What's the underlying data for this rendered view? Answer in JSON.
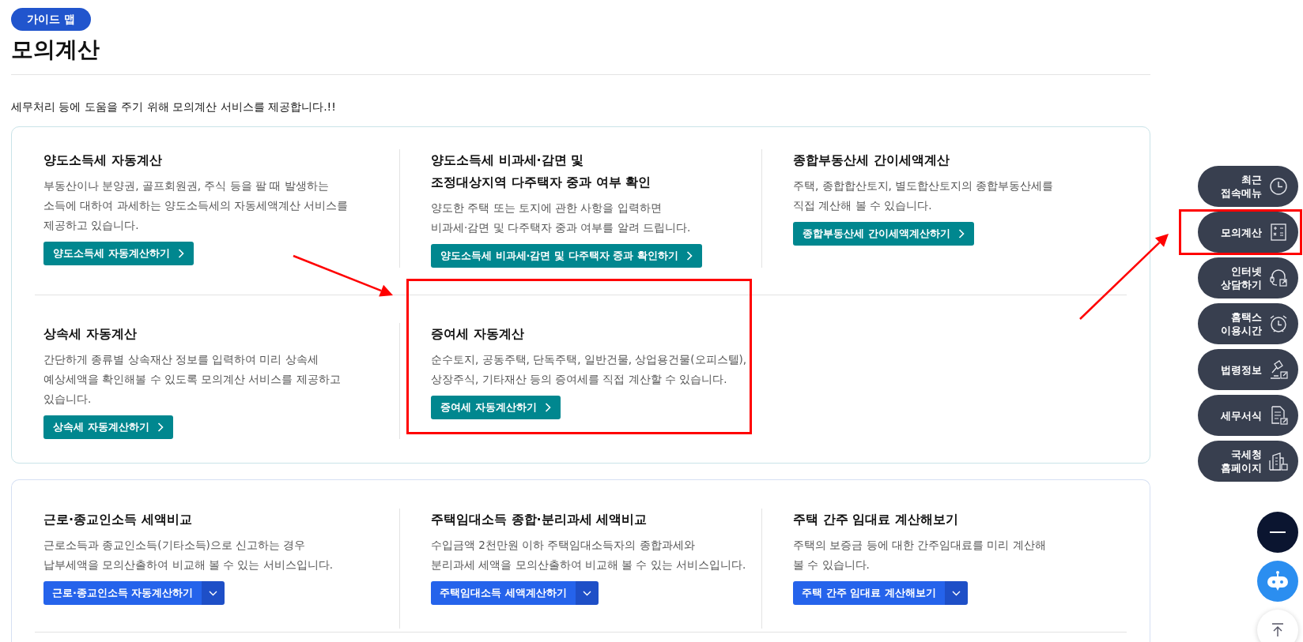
{
  "guide_badge": "가이드 맵",
  "page_title": "모의계산",
  "intro": "세무처리 등에 도움을 주기 위해 모의계산 서비스를 제공합니다.!!",
  "sections": [
    {
      "rows": [
        [
          {
            "title_lines": [
              "양도소득세 자동계산"
            ],
            "desc_lines": [
              "부동산이나 분양권, 골프회원권, 주식 등을 팔 때 발생하는",
              "소득에 대하여 과세하는 양도소득세의 자동세액계산 서비스를",
              "제공하고 있습니다."
            ],
            "button": {
              "kind": "link",
              "label": "양도소득세 자동계산하기"
            },
            "highlighted": false
          },
          {
            "title_lines": [
              "양도소득세 비과세·감면 및",
              "조정대상지역 다주택자 중과 여부 확인"
            ],
            "desc_lines": [
              "양도한 주택 또는 토지에 관한 사항을 입력하면",
              "비과세·감면 및 다주택자 중과 여부를 알려 드립니다."
            ],
            "button": {
              "kind": "link",
              "label": "양도소득세 비과세·감면 및 다주택자 중과 확인하기"
            },
            "highlighted": false
          },
          {
            "title_lines": [
              "종합부동산세 간이세액계산"
            ],
            "desc_lines": [
              "주택, 종합합산토지, 별도합산토지의 종합부동산세를",
              "직접 계산해 볼 수 있습니다."
            ],
            "button": {
              "kind": "link",
              "label": "종합부동산세 간이세액계산하기"
            },
            "highlighted": false
          }
        ],
        [
          {
            "title_lines": [
              "상속세 자동계산"
            ],
            "desc_lines": [
              "간단하게 종류별 상속재산 정보를 입력하여 미리 상속세",
              "예상세액을 확인해볼 수 있도록 모의계산 서비스를 제공하고",
              "있습니다."
            ],
            "button": {
              "kind": "link",
              "label": "상속세 자동계산하기"
            },
            "highlighted": false
          },
          {
            "title_lines": [
              "증여세 자동계산"
            ],
            "desc_lines": [
              "순수토지, 공동주택, 단독주택, 일반건물, 상업용건물(오피스텔),",
              "상장주식, 기타재산 등의 증여세를 직접 계산할 수 있습니다."
            ],
            "button": {
              "kind": "link",
              "label": "증여세 자동계산하기"
            },
            "highlighted": true
          }
        ]
      ]
    },
    {
      "rows": [
        [
          {
            "title_lines": [
              "근로·종교인소득 세액비교"
            ],
            "desc_lines": [
              "근로소득과 종교인소득(기타소득)으로 신고하는 경우",
              "납부세액을 모의산출하여 비교해 볼 수 있는 서비스입니다."
            ],
            "button": {
              "kind": "split",
              "label": "근로·종교인소득 자동계산하기"
            },
            "highlighted": false
          },
          {
            "title_lines": [
              "주택임대소득 종합·분리과세 세액비교"
            ],
            "desc_lines": [
              "수입금액 2천만원 이하 주택임대소득자의 종합과세와",
              "분리과세 세액을 모의산출하여 비교해 볼 수 있는 서비스입니다."
            ],
            "button": {
              "kind": "split",
              "label": "주택임대소득 세액계산하기"
            },
            "highlighted": false
          },
          {
            "title_lines": [
              "주택 간주 임대료 계산해보기"
            ],
            "desc_lines": [
              "주택의 보증금 등에 대한 간주임대료를 미리 계산해",
              "볼 수 있습니다."
            ],
            "button": {
              "kind": "split",
              "label": "주택 간주 임대료 계산해보기"
            },
            "highlighted": false
          }
        ]
      ]
    }
  ],
  "quick_menu": [
    {
      "label_lines": [
        "최근",
        "접속메뉴"
      ],
      "highlighted": false
    },
    {
      "label_lines": [
        "모의계산"
      ],
      "highlighted": true
    },
    {
      "label_lines": [
        "인터넷",
        "상담하기"
      ],
      "highlighted": false
    },
    {
      "label_lines": [
        "홈택스",
        "이용시간"
      ],
      "highlighted": false
    },
    {
      "label_lines": [
        "법령정보"
      ],
      "highlighted": false
    },
    {
      "label_lines": [
        "세무서식"
      ],
      "highlighted": false
    },
    {
      "label_lines": [
        "국세청",
        "홈페이지"
      ],
      "highlighted": false
    }
  ],
  "float_buttons": [
    {
      "kind": "collapse"
    },
    {
      "kind": "chatbot"
    },
    {
      "kind": "top"
    }
  ]
}
